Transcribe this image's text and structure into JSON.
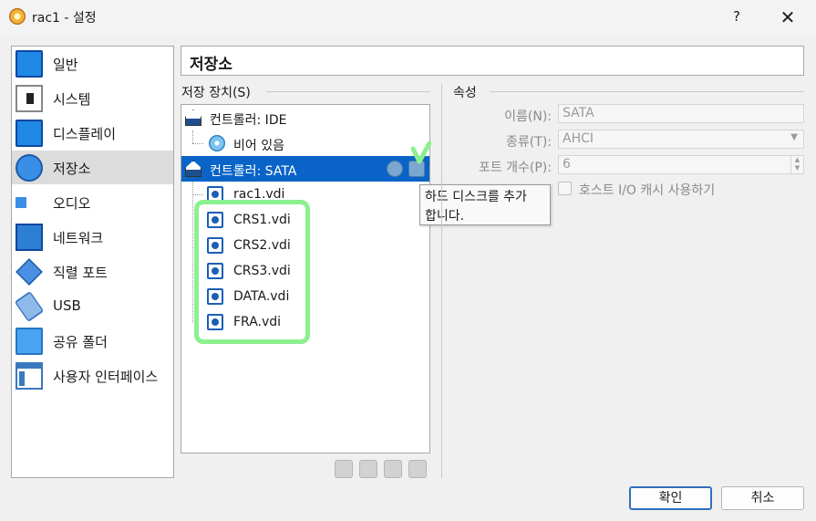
{
  "window": {
    "title": "rac1 - 설정",
    "help": "?",
    "close": "✕"
  },
  "sidebar": {
    "items": [
      {
        "label": "일반",
        "icon": "monitor-icon"
      },
      {
        "label": "시스템",
        "icon": "chip-icon"
      },
      {
        "label": "디스플레이",
        "icon": "display-icon"
      },
      {
        "label": "저장소",
        "icon": "disk-icon",
        "selected": true
      },
      {
        "label": "오디오",
        "icon": "speaker-icon"
      },
      {
        "label": "네트워크",
        "icon": "network-icon"
      },
      {
        "label": "직렬 포트",
        "icon": "serial-port-icon"
      },
      {
        "label": "USB",
        "icon": "usb-icon"
      },
      {
        "label": "공유 폴더",
        "icon": "folder-icon"
      },
      {
        "label": "사용자 인터페이스",
        "icon": "user-interface-icon"
      }
    ]
  },
  "page": {
    "title": "저장소"
  },
  "storage": {
    "group_label": "저장 장치(S)",
    "tree": [
      {
        "label": "컨트롤러: IDE"
      },
      {
        "label": "비어 있음"
      },
      {
        "label": "컨트롤러: SATA",
        "selected": true
      },
      {
        "label": "rac1.vdi"
      },
      {
        "label": "CRS1.vdi"
      },
      {
        "label": "CRS2.vdi"
      },
      {
        "label": "CRS3.vdi"
      },
      {
        "label": "DATA.vdi"
      },
      {
        "label": "FRA.vdi"
      }
    ],
    "tooltip": [
      "하드 디스크를 추가",
      "합니다."
    ]
  },
  "attributes": {
    "group_label": "속성",
    "name_label": "이름(N):",
    "name_value": "SATA",
    "type_label": "종류(T):",
    "type_value": "AHCI",
    "ports_label": "포트 개수(P):",
    "ports_value": "6",
    "cache_label": "호스트 I/O 캐시 사용하기",
    "cache_checked": false
  },
  "buttons": {
    "ok": "확인",
    "cancel": "취소"
  },
  "colors": {
    "selection": "#0a64c8",
    "annotation": "#8bf08f"
  }
}
